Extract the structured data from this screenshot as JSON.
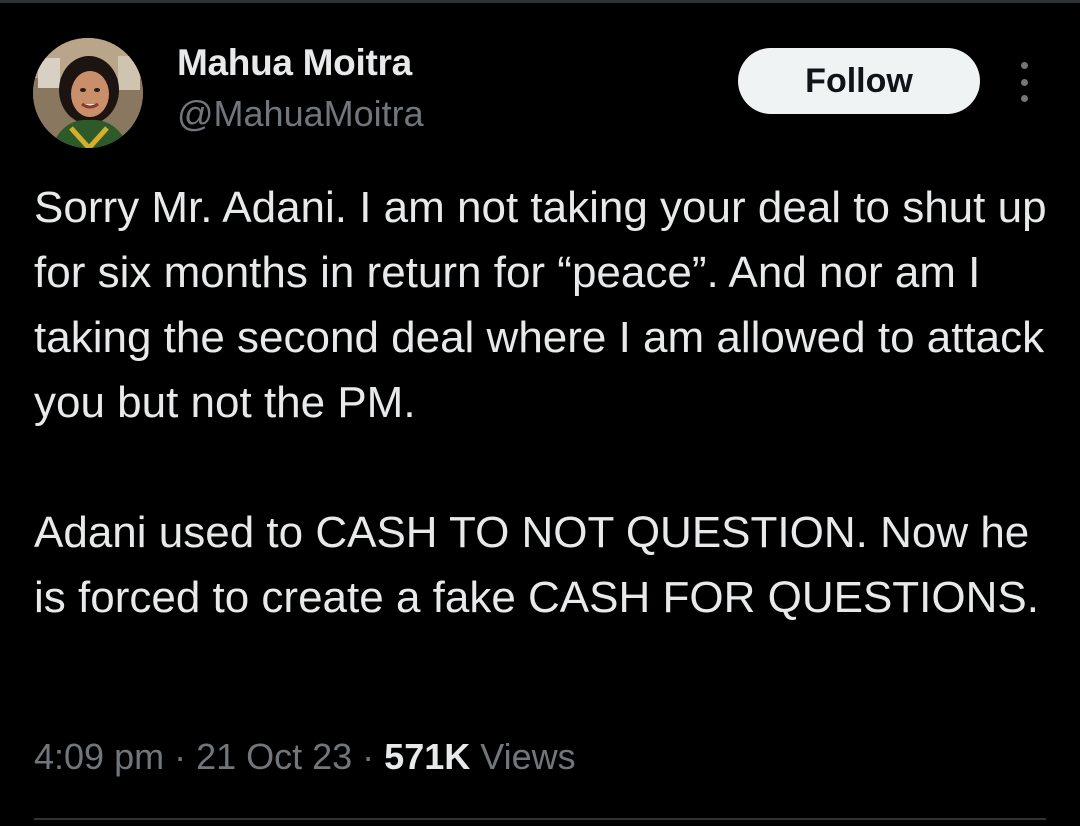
{
  "author": {
    "display_name": "Mahua Moitra",
    "handle": "@MahuaMoitra",
    "avatar_icon": "profile-photo"
  },
  "actions": {
    "follow_label": "Follow",
    "more_icon": "more-vertical-icon"
  },
  "tweet": {
    "paragraph_1": "Sorry Mr. Adani. I am not taking your deal to shut up for six months in return for “peace”. And nor am I taking the second deal where I am allowed to attack you but not the PM.",
    "paragraph_2": "Adani used to CASH TO NOT QUESTION. Now he is forced to create a fake CASH FOR QUESTIONS."
  },
  "meta": {
    "time": "4:09 pm",
    "separator": " · ",
    "date": "21 Oct 23",
    "views_count": "571K",
    "views_label": " Views"
  },
  "colors": {
    "background": "#000000",
    "primary_text": "#e7e9ea",
    "secondary_text": "#71767b",
    "follow_button_bg": "#eff3f4",
    "follow_button_text": "#0f1419"
  }
}
